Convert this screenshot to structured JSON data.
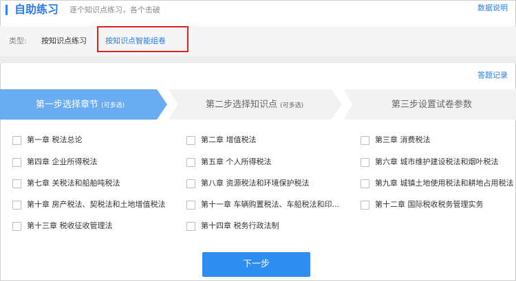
{
  "header": {
    "title": "自助练习",
    "subtitle": "逐个知识点练习，各个击破",
    "data_link": "数据说明"
  },
  "type_row": {
    "label": "类型:",
    "options": [
      "按知识点练习",
      "按知识点智能组卷"
    ]
  },
  "answer_record": "答题记录",
  "steps": [
    {
      "label": "第一步选择章节",
      "note": "(可多选)",
      "active": true
    },
    {
      "label": "第二步选择知识点",
      "note": "(可多选)",
      "active": false
    },
    {
      "label": "第三步设置试卷参数",
      "note": "",
      "active": false
    }
  ],
  "colors": {
    "accent": "#2b7ce9",
    "step_active": "#6aacf2",
    "step_inactive": "#f2f2f2",
    "highlight_border": "#e02020",
    "button": "#2f8cf0"
  },
  "chapters": [
    {
      "label": "第一章 税法总论"
    },
    {
      "label": "第二章 增值税法"
    },
    {
      "label": "第三章 消费税法"
    },
    {
      "label": "第四章 企业所得税法"
    },
    {
      "label": "第五章 个人所得税法"
    },
    {
      "label": "第六章 城市维护建设税法和烟叶税法"
    },
    {
      "label": "第七章 关税法和船舶吨税法"
    },
    {
      "label": "第八章 资源税法和环境保护税法"
    },
    {
      "label": "第九章 城镇土地使用税法和耕地占用税法"
    },
    {
      "label": "第十章 房产税法、契税法和土地增值税法"
    },
    {
      "label": "第十一章 车辆购置税法、车船税法和印..."
    },
    {
      "label": "第十二章 国际税收税务管理实务"
    },
    {
      "label": "第十三章 税收征收管理法"
    },
    {
      "label": "第十四章 税务行政法制"
    }
  ],
  "next_button": "下一步"
}
